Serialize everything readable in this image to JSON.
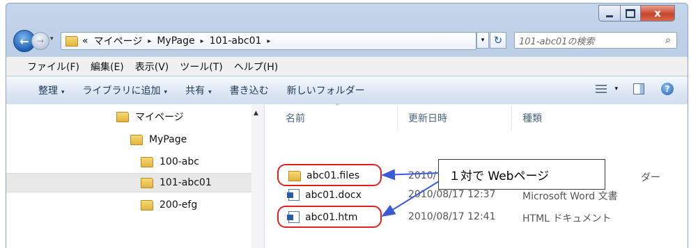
{
  "window": {
    "close_glyph": "x"
  },
  "nav": {
    "back_glyph": "←",
    "forward_glyph": "→",
    "dropdown_glyph": "▾"
  },
  "address": {
    "prefix": "«",
    "crumbs": [
      "マイページ",
      "MyPage",
      "101-abc01"
    ],
    "separator": "▸",
    "dropdown_glyph": "▾",
    "refresh_glyph": "↻"
  },
  "search": {
    "placeholder": "101-abc01の検索",
    "icon_glyph": "⌕"
  },
  "menu": {
    "items": [
      "ファイル(F)",
      "編集(E)",
      "表示(V)",
      "ツール(T)",
      "ヘルプ(H)"
    ]
  },
  "commands": {
    "organize": "整理",
    "add_to_library": "ライブラリに追加",
    "share": "共有",
    "burn": "書き込む",
    "new_folder": "新しいフォルダー",
    "dropdown_glyph": "▾",
    "help_glyph": "?"
  },
  "tree": {
    "items": [
      "マイページ",
      "MyPage",
      "100-abc",
      "101-abc01",
      "200-efg"
    ],
    "selected": "101-abc01",
    "scroll_up_glyph": "▲"
  },
  "columns": {
    "name": "名前",
    "date": "更新日時",
    "type": "種類",
    "sort_glyph": "^"
  },
  "files": [
    {
      "name": "abc01.files",
      "date": "2010/",
      "type": "ダー"
    },
    {
      "name": "abc01.docx",
      "date": "2010/08/17 12:37",
      "type": "Microsoft Word 文書"
    },
    {
      "name": "abc01.htm",
      "date": "2010/08/17 12:41",
      "type": "HTML ドキュメント"
    }
  ],
  "callout": {
    "text": "１対で Webページ"
  },
  "colors": {
    "highlight": "#e02020",
    "arrow": "#3b5bd6",
    "command_text": "#1e395b"
  }
}
